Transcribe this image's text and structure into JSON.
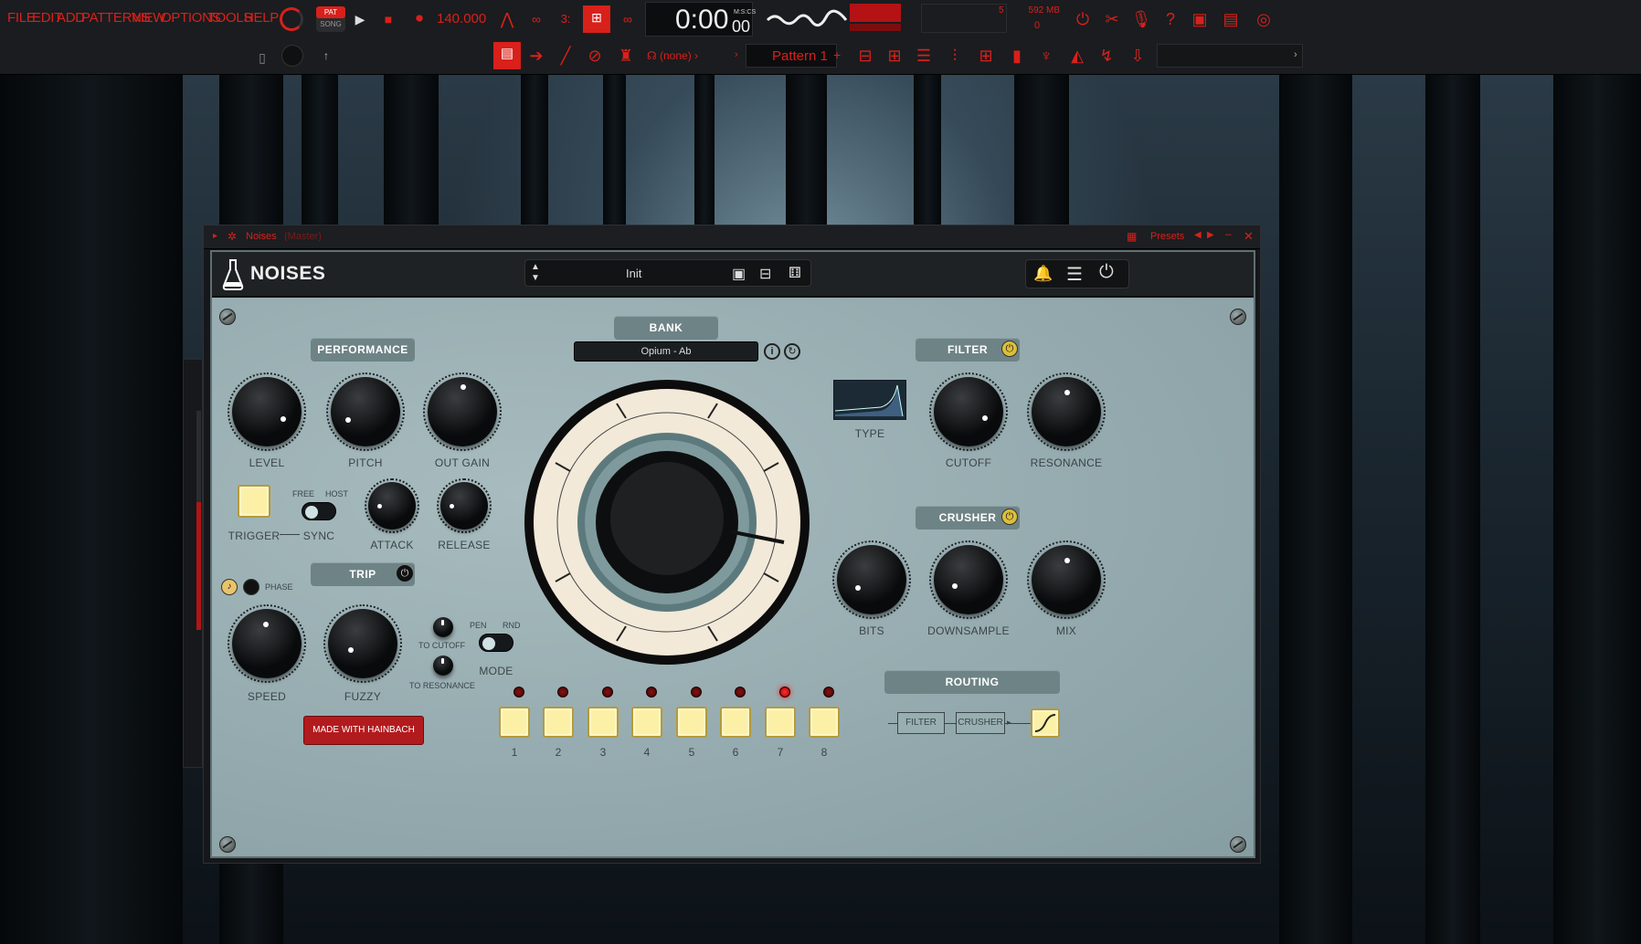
{
  "toolbar": {
    "menu": [
      "FILE",
      "EDIT",
      "ADD",
      "PATTERNS",
      "VIEW",
      "OPTIONS",
      "TOOLS",
      "HELP"
    ],
    "pat_label": "PAT",
    "song_label": "SONG",
    "tempo": "140.000",
    "time": "0:00",
    "time_small": "00",
    "time_unit": "M:S:CS",
    "memory": "592 MB",
    "cpu_top": "5",
    "cpu_bottom": "0",
    "channel": "(none)",
    "pattern": "Pattern 1"
  },
  "window": {
    "title": "Noises",
    "title_sub": "(Master)",
    "presets": "Presets"
  },
  "plugin": {
    "name": "NOISES",
    "preset_name": "Init",
    "sections": {
      "performance": "PERFORMANCE",
      "bank": "BANK",
      "filter": "FILTER",
      "crusher": "CRUSHER",
      "trip": "TRIP",
      "routing": "ROUTING"
    },
    "bank_value": "Opium - Ab",
    "knobs": {
      "level": "LEVEL",
      "pitch": "PITCH",
      "out_gain": "OUT GAIN",
      "attack": "ATTACK",
      "release": "RELEASE",
      "cutoff": "CUTOFF",
      "resonance": "RESONANCE",
      "bits": "BITS",
      "downsample": "DOWNSAMPLE",
      "mix": "MIX",
      "speed": "SPEED",
      "fuzzy": "FUZZY",
      "to_cutoff": "TO CUTOFF",
      "to_resonance": "TO RESONANCE"
    },
    "trigger": "TRIGGER",
    "sync": "SYNC",
    "free": "FREE",
    "host": "HOST",
    "phase": "PHASE",
    "pen": "PEN",
    "rnd": "RND",
    "mode": "MODE",
    "type": "TYPE",
    "made_with": "MADE WITH HAINBACH",
    "routing_filter": "FILTER",
    "routing_crusher": "CRUSHER",
    "pads": [
      "1",
      "2",
      "3",
      "4",
      "5",
      "6",
      "7",
      "8"
    ],
    "active_led": 7
  }
}
